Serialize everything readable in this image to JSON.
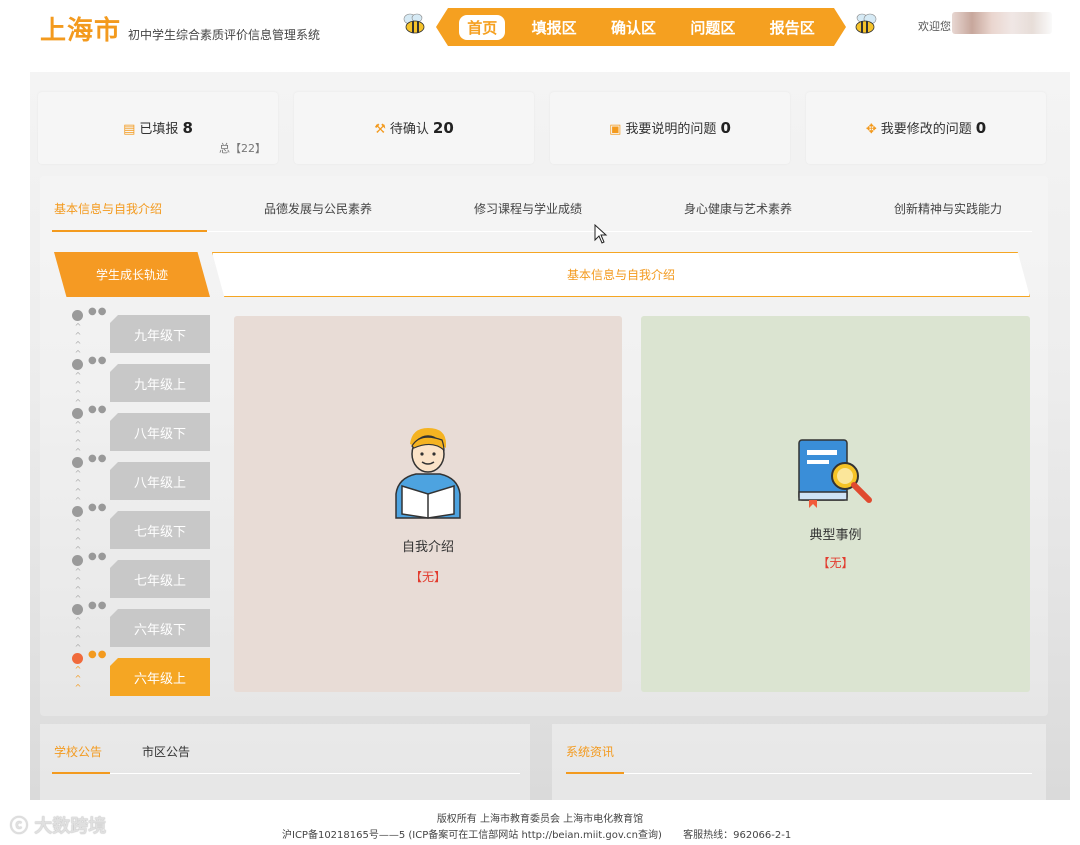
{
  "header": {
    "city": "上海市",
    "subtitle": "初中学生综合素质评价信息管理系统",
    "nav": [
      "首页",
      "填报区",
      "确认区",
      "问题区",
      "报告区"
    ],
    "active_nav": "首页",
    "welcome": "欢迎您"
  },
  "stats": [
    {
      "label": "已填报",
      "value": "8",
      "sub": "总【22】",
      "icon": "document-icon"
    },
    {
      "label": "待确认",
      "value": "20",
      "icon": "hammer-icon"
    },
    {
      "label": "我要说明的问题",
      "value": "0",
      "icon": "note-icon"
    },
    {
      "label": "我要修改的问题",
      "value": "0",
      "icon": "puzzle-icon"
    }
  ],
  "tabs": [
    "基本信息与自我介绍",
    "品德发展与公民素养",
    "修习课程与学业成绩",
    "身心健康与艺术素养",
    "创新精神与实践能力"
  ],
  "timeline_title": "学生成长轨迹",
  "section_title": "基本信息与自我介绍",
  "grades": [
    "九年级下",
    "九年级上",
    "八年级下",
    "八年级上",
    "七年级下",
    "七年级上",
    "六年级下",
    "六年级上"
  ],
  "active_grade": "六年级上",
  "cards": [
    {
      "label": "自我介绍",
      "status": "【无】",
      "icon": "student-reading-icon"
    },
    {
      "label": "典型事例",
      "status": "【无】",
      "icon": "book-search-icon"
    }
  ],
  "bottom": {
    "left_tabs": [
      "学校公告",
      "市区公告"
    ],
    "right_tabs": [
      "系统资讯"
    ]
  },
  "footer": {
    "line1": "版权所有 上海市教育委员会 上海市电化教育馆",
    "line2": "沪ICP备10218165号——5 (ICP备案可在工信部网站 http://beian.miit.gov.cn查询)",
    "hotline": "客服热线：962066-2-1"
  },
  "watermark": "大数跨境",
  "colors": {
    "accent": "#f5a020",
    "status": "#e23b2e",
    "inactive_grade": "#c8c8c8"
  }
}
